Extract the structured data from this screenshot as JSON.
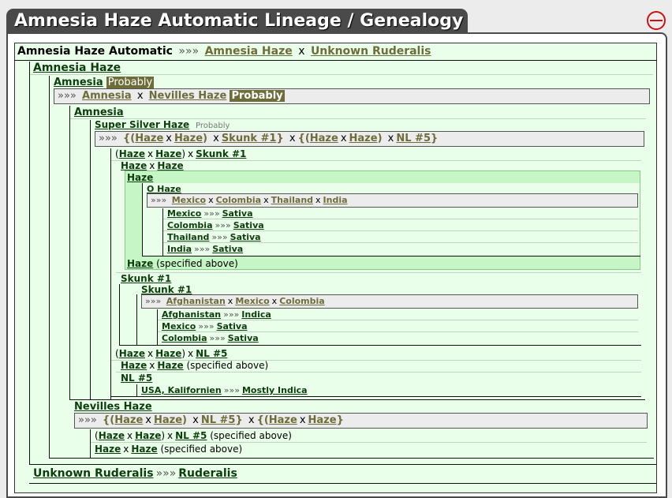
{
  "header": {
    "title": "Amnesia Haze Automatic Lineage / Genealogy",
    "collapse_icon": "minus-circle-icon"
  },
  "colors": {
    "accent": "#6d6d39",
    "panel_bg": "#eaffea",
    "highlight": "#c6f5c6",
    "tab": "#4a4a4a",
    "collapse": "#cc1111"
  },
  "terms": {
    "x": "x",
    "arrow": "»»»",
    "probably": "Probably",
    "specified": "(specified above)",
    "lp": "(",
    "rp": ")",
    "lb": "{(",
    "rb": "}"
  },
  "root": {
    "name": "Amnesia Haze Automatic",
    "parent1": "Amnesia Haze",
    "parent2": "Unknown Ruderalis"
  },
  "amnesia_haze": {
    "label": "Amnesia Haze"
  },
  "amnesia": {
    "label": "Amnesia",
    "badge": "Probably",
    "parent1": "Amnesia",
    "parent2": "Nevilles Haze",
    "badge2": "Probably"
  },
  "amnesia_inner": {
    "label": "Amnesia"
  },
  "super_silver": {
    "label": "Super Silver Haze",
    "badge": "Probably",
    "p1": "Haze",
    "p2": "Haze",
    "p3": "Skunk #1",
    "p4": "Haze",
    "p5": "Haze",
    "p6": "NL #5"
  },
  "hhs": {
    "a": "Haze",
    "b": "Haze",
    "c": "Skunk #1"
  },
  "hh": {
    "a": "Haze",
    "b": "Haze"
  },
  "haze": {
    "label": "Haze"
  },
  "ohaze": {
    "label": "O Haze",
    "p1": "Mexico",
    "p2": "Colombia",
    "p3": "Thailand",
    "p4": "India"
  },
  "landraces": [
    {
      "name": "Mexico",
      "type": "Sativa"
    },
    {
      "name": "Colombia",
      "type": "Sativa"
    },
    {
      "name": "Thailand",
      "type": "Sativa"
    },
    {
      "name": "India",
      "type": "Sativa"
    }
  ],
  "haze_ref": {
    "name": "Haze",
    "note": "(specified above)"
  },
  "skunk_outer": {
    "label": "Skunk #1"
  },
  "skunk": {
    "label": "Skunk #1",
    "p1": "Afghanistan",
    "p2": "Mexico",
    "p3": "Colombia"
  },
  "skunk_landraces": [
    {
      "name": "Afghanistan",
      "type": "Indica"
    },
    {
      "name": "Mexico",
      "type": "Sativa"
    },
    {
      "name": "Colombia",
      "type": "Sativa"
    }
  ],
  "hhn": {
    "a": "Haze",
    "b": "Haze",
    "c": "NL #5"
  },
  "hh_ref": {
    "a": "Haze",
    "b": "Haze",
    "note": "(specified above)"
  },
  "nl5": {
    "label": "NL #5",
    "origin": "USA, Kalifornien",
    "type": "Mostly Indica"
  },
  "nevilles": {
    "label": "Nevilles Haze",
    "p1": "Haze",
    "p2": "Haze",
    "p3": "NL #5",
    "p4": "Haze",
    "p5": "Haze"
  },
  "hhn_ref": {
    "a": "Haze",
    "b": "Haze",
    "c": "NL #5",
    "note": "(specified above)"
  },
  "hh_ref2": {
    "a": "Haze",
    "b": "Haze",
    "note": "(specified above)"
  },
  "unknown": {
    "name": "Unknown Ruderalis",
    "type": "Ruderalis"
  }
}
